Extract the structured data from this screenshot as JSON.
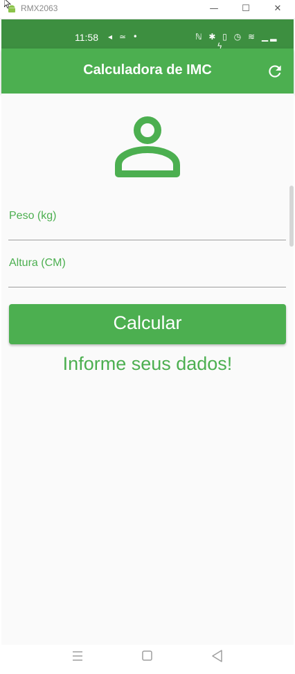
{
  "window": {
    "title": "RMX2063",
    "minimize": "—",
    "maximize": "☐",
    "close": "✕"
  },
  "statusbar": {
    "time": "11:58",
    "left_icons": "◂ ≃ •",
    "right_icons": "ℕ ✱ ▯ ◷ ≋ ▁▂ ▁▂ ϟ"
  },
  "appbar": {
    "title": "Calculadora de IMC"
  },
  "form": {
    "weight_label": "Peso (kg)",
    "height_label": "Altura (CM)",
    "calculate_label": "Calcular"
  },
  "result": {
    "text": "Informe seus dados!"
  },
  "colors": {
    "primary": "#4caf50",
    "status": "#3d8f40",
    "background": "#fafafa"
  }
}
